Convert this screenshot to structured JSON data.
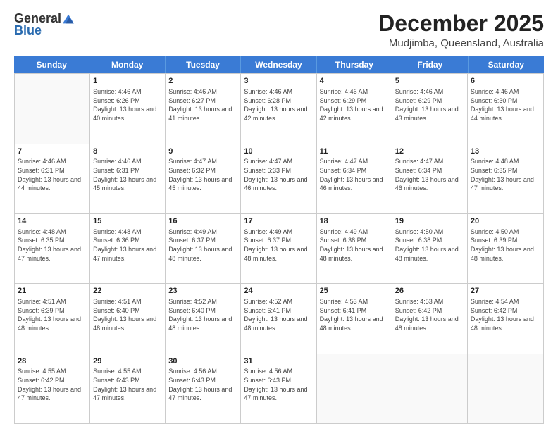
{
  "logo": {
    "general": "General",
    "blue": "Blue"
  },
  "title": "December 2025",
  "location": "Mudjimba, Queensland, Australia",
  "days_header": [
    "Sunday",
    "Monday",
    "Tuesday",
    "Wednesday",
    "Thursday",
    "Friday",
    "Saturday"
  ],
  "weeks": [
    [
      {
        "day": "",
        "sunrise": "",
        "sunset": "",
        "daylight": "",
        "empty": true
      },
      {
        "day": "1",
        "sunrise": "Sunrise: 4:46 AM",
        "sunset": "Sunset: 6:26 PM",
        "daylight": "Daylight: 13 hours and 40 minutes.",
        "empty": false
      },
      {
        "day": "2",
        "sunrise": "Sunrise: 4:46 AM",
        "sunset": "Sunset: 6:27 PM",
        "daylight": "Daylight: 13 hours and 41 minutes.",
        "empty": false
      },
      {
        "day": "3",
        "sunrise": "Sunrise: 4:46 AM",
        "sunset": "Sunset: 6:28 PM",
        "daylight": "Daylight: 13 hours and 42 minutes.",
        "empty": false
      },
      {
        "day": "4",
        "sunrise": "Sunrise: 4:46 AM",
        "sunset": "Sunset: 6:29 PM",
        "daylight": "Daylight: 13 hours and 42 minutes.",
        "empty": false
      },
      {
        "day": "5",
        "sunrise": "Sunrise: 4:46 AM",
        "sunset": "Sunset: 6:29 PM",
        "daylight": "Daylight: 13 hours and 43 minutes.",
        "empty": false
      },
      {
        "day": "6",
        "sunrise": "Sunrise: 4:46 AM",
        "sunset": "Sunset: 6:30 PM",
        "daylight": "Daylight: 13 hours and 44 minutes.",
        "empty": false
      }
    ],
    [
      {
        "day": "7",
        "sunrise": "Sunrise: 4:46 AM",
        "sunset": "Sunset: 6:31 PM",
        "daylight": "Daylight: 13 hours and 44 minutes.",
        "empty": false
      },
      {
        "day": "8",
        "sunrise": "Sunrise: 4:46 AM",
        "sunset": "Sunset: 6:31 PM",
        "daylight": "Daylight: 13 hours and 45 minutes.",
        "empty": false
      },
      {
        "day": "9",
        "sunrise": "Sunrise: 4:47 AM",
        "sunset": "Sunset: 6:32 PM",
        "daylight": "Daylight: 13 hours and 45 minutes.",
        "empty": false
      },
      {
        "day": "10",
        "sunrise": "Sunrise: 4:47 AM",
        "sunset": "Sunset: 6:33 PM",
        "daylight": "Daylight: 13 hours and 46 minutes.",
        "empty": false
      },
      {
        "day": "11",
        "sunrise": "Sunrise: 4:47 AM",
        "sunset": "Sunset: 6:34 PM",
        "daylight": "Daylight: 13 hours and 46 minutes.",
        "empty": false
      },
      {
        "day": "12",
        "sunrise": "Sunrise: 4:47 AM",
        "sunset": "Sunset: 6:34 PM",
        "daylight": "Daylight: 13 hours and 46 minutes.",
        "empty": false
      },
      {
        "day": "13",
        "sunrise": "Sunrise: 4:48 AM",
        "sunset": "Sunset: 6:35 PM",
        "daylight": "Daylight: 13 hours and 47 minutes.",
        "empty": false
      }
    ],
    [
      {
        "day": "14",
        "sunrise": "Sunrise: 4:48 AM",
        "sunset": "Sunset: 6:35 PM",
        "daylight": "Daylight: 13 hours and 47 minutes.",
        "empty": false
      },
      {
        "day": "15",
        "sunrise": "Sunrise: 4:48 AM",
        "sunset": "Sunset: 6:36 PM",
        "daylight": "Daylight: 13 hours and 47 minutes.",
        "empty": false
      },
      {
        "day": "16",
        "sunrise": "Sunrise: 4:49 AM",
        "sunset": "Sunset: 6:37 PM",
        "daylight": "Daylight: 13 hours and 48 minutes.",
        "empty": false
      },
      {
        "day": "17",
        "sunrise": "Sunrise: 4:49 AM",
        "sunset": "Sunset: 6:37 PM",
        "daylight": "Daylight: 13 hours and 48 minutes.",
        "empty": false
      },
      {
        "day": "18",
        "sunrise": "Sunrise: 4:49 AM",
        "sunset": "Sunset: 6:38 PM",
        "daylight": "Daylight: 13 hours and 48 minutes.",
        "empty": false
      },
      {
        "day": "19",
        "sunrise": "Sunrise: 4:50 AM",
        "sunset": "Sunset: 6:38 PM",
        "daylight": "Daylight: 13 hours and 48 minutes.",
        "empty": false
      },
      {
        "day": "20",
        "sunrise": "Sunrise: 4:50 AM",
        "sunset": "Sunset: 6:39 PM",
        "daylight": "Daylight: 13 hours and 48 minutes.",
        "empty": false
      }
    ],
    [
      {
        "day": "21",
        "sunrise": "Sunrise: 4:51 AM",
        "sunset": "Sunset: 6:39 PM",
        "daylight": "Daylight: 13 hours and 48 minutes.",
        "empty": false
      },
      {
        "day": "22",
        "sunrise": "Sunrise: 4:51 AM",
        "sunset": "Sunset: 6:40 PM",
        "daylight": "Daylight: 13 hours and 48 minutes.",
        "empty": false
      },
      {
        "day": "23",
        "sunrise": "Sunrise: 4:52 AM",
        "sunset": "Sunset: 6:40 PM",
        "daylight": "Daylight: 13 hours and 48 minutes.",
        "empty": false
      },
      {
        "day": "24",
        "sunrise": "Sunrise: 4:52 AM",
        "sunset": "Sunset: 6:41 PM",
        "daylight": "Daylight: 13 hours and 48 minutes.",
        "empty": false
      },
      {
        "day": "25",
        "sunrise": "Sunrise: 4:53 AM",
        "sunset": "Sunset: 6:41 PM",
        "daylight": "Daylight: 13 hours and 48 minutes.",
        "empty": false
      },
      {
        "day": "26",
        "sunrise": "Sunrise: 4:53 AM",
        "sunset": "Sunset: 6:42 PM",
        "daylight": "Daylight: 13 hours and 48 minutes.",
        "empty": false
      },
      {
        "day": "27",
        "sunrise": "Sunrise: 4:54 AM",
        "sunset": "Sunset: 6:42 PM",
        "daylight": "Daylight: 13 hours and 48 minutes.",
        "empty": false
      }
    ],
    [
      {
        "day": "28",
        "sunrise": "Sunrise: 4:55 AM",
        "sunset": "Sunset: 6:42 PM",
        "daylight": "Daylight: 13 hours and 47 minutes.",
        "empty": false
      },
      {
        "day": "29",
        "sunrise": "Sunrise: 4:55 AM",
        "sunset": "Sunset: 6:43 PM",
        "daylight": "Daylight: 13 hours and 47 minutes.",
        "empty": false
      },
      {
        "day": "30",
        "sunrise": "Sunrise: 4:56 AM",
        "sunset": "Sunset: 6:43 PM",
        "daylight": "Daylight: 13 hours and 47 minutes.",
        "empty": false
      },
      {
        "day": "31",
        "sunrise": "Sunrise: 4:56 AM",
        "sunset": "Sunset: 6:43 PM",
        "daylight": "Daylight: 13 hours and 47 minutes.",
        "empty": false
      },
      {
        "day": "",
        "sunrise": "",
        "sunset": "",
        "daylight": "",
        "empty": true
      },
      {
        "day": "",
        "sunrise": "",
        "sunset": "",
        "daylight": "",
        "empty": true
      },
      {
        "day": "",
        "sunrise": "",
        "sunset": "",
        "daylight": "",
        "empty": true
      }
    ]
  ]
}
